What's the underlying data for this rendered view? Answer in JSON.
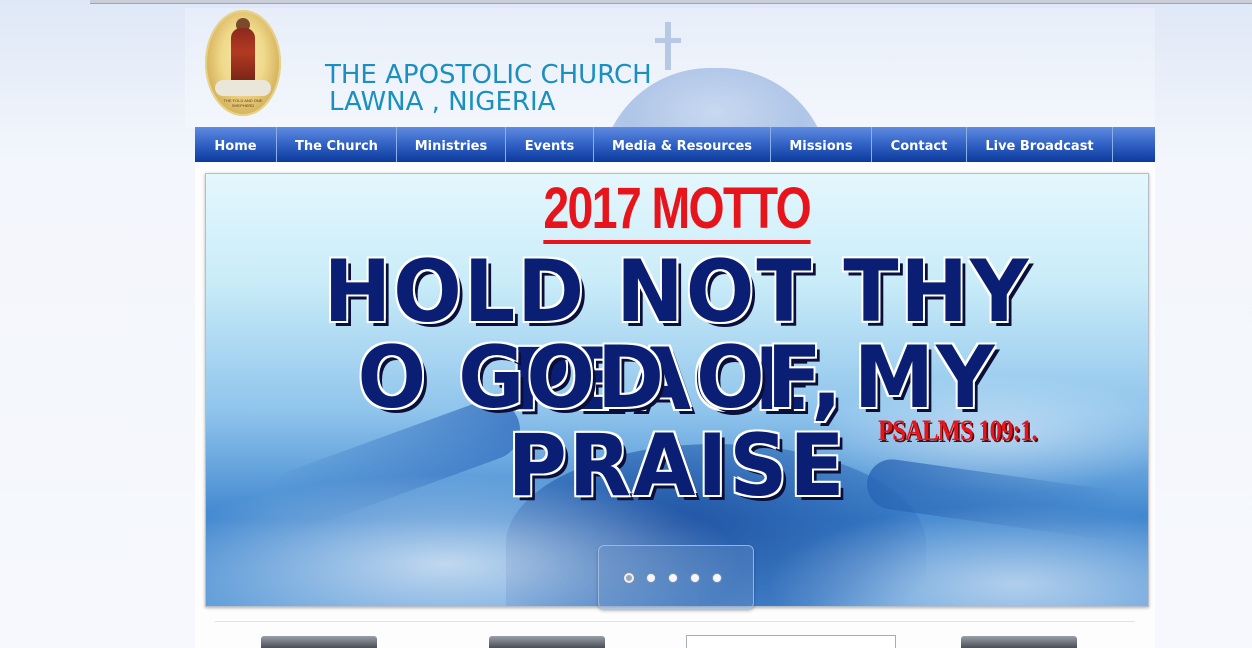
{
  "site": {
    "title_line1": "THE APOSTOLIC CHURCH",
    "title_line2": "LAWNA , NIGERIA",
    "logo_text": "THE FOLD AND ONE SHEPHERD"
  },
  "nav": {
    "items": [
      {
        "label": "Home"
      },
      {
        "label": "The Church"
      },
      {
        "label": "Ministries"
      },
      {
        "label": "Events"
      },
      {
        "label": "Media & Resources"
      },
      {
        "label": "Missions"
      },
      {
        "label": "Contact"
      },
      {
        "label": "Live Broadcast"
      }
    ]
  },
  "slider": {
    "headline": "2017 MOTTO",
    "line1": "HOLD NOT  THY PEACE,",
    "line2": "O GOD OF MY PRAISE",
    "scripture": "PSALMS 109:1.",
    "slide_count": 5,
    "active_slide": 1
  },
  "colors": {
    "nav_bar": "#3565c8",
    "title_text": "#1a8fc0",
    "motto_red": "#e8141b",
    "motto_navy": "#0a1f73"
  }
}
